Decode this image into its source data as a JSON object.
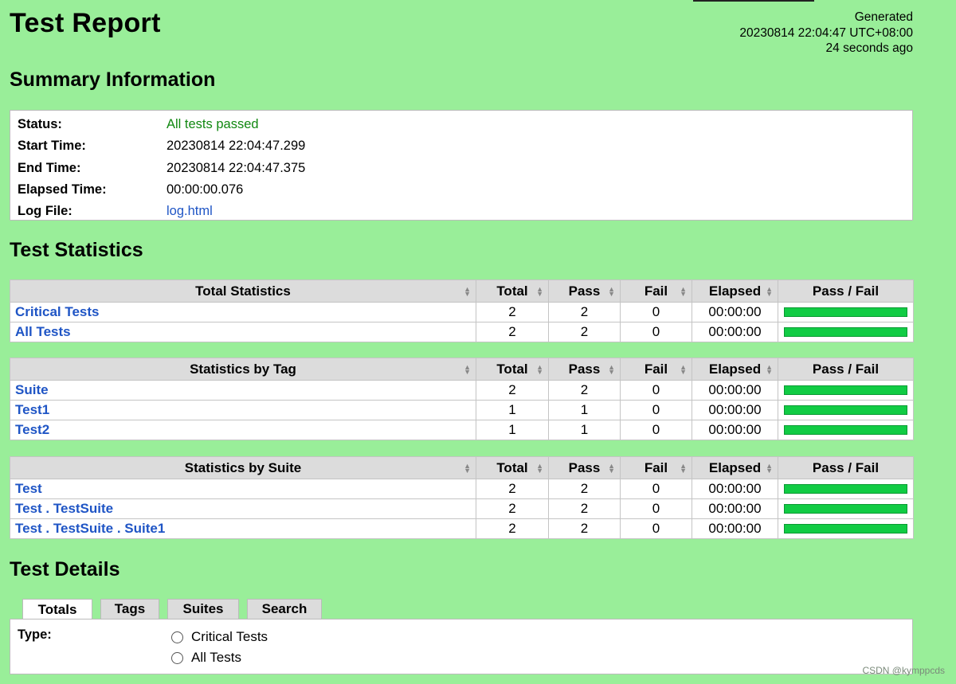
{
  "header": {
    "title": "Test Report",
    "generated_label": "Generated",
    "generated_time": "20230814 22:04:47 UTC+08:00",
    "generated_ago": "24 seconds ago"
  },
  "summary": {
    "heading": "Summary Information",
    "rows": [
      {
        "label": "Status:",
        "value": "All tests passed"
      },
      {
        "label": "Start Time:",
        "value": "20230814 22:04:47.299"
      },
      {
        "label": "End Time:",
        "value": "20230814 22:04:47.375"
      },
      {
        "label": "Elapsed Time:",
        "value": "00:00:00.076"
      },
      {
        "label": "Log File:",
        "value": "log.html"
      }
    ],
    "status_color": "#118811"
  },
  "statistics": {
    "heading": "Test Statistics",
    "columns": [
      "Total",
      "Pass",
      "Fail",
      "Elapsed",
      "Pass / Fail"
    ],
    "tables": [
      {
        "title": "Total Statistics",
        "rows": [
          {
            "name": "Critical Tests",
            "total": "2",
            "pass": "2",
            "fail": "0",
            "elapsed": "00:00:00",
            "pass_ratio": 1.0
          },
          {
            "name": "All Tests",
            "total": "2",
            "pass": "2",
            "fail": "0",
            "elapsed": "00:00:00",
            "pass_ratio": 1.0
          }
        ]
      },
      {
        "title": "Statistics by Tag",
        "rows": [
          {
            "name": "Suite",
            "total": "2",
            "pass": "2",
            "fail": "0",
            "elapsed": "00:00:00",
            "pass_ratio": 1.0
          },
          {
            "name": "Test1",
            "total": "1",
            "pass": "1",
            "fail": "0",
            "elapsed": "00:00:00",
            "pass_ratio": 1.0
          },
          {
            "name": "Test2",
            "total": "1",
            "pass": "1",
            "fail": "0",
            "elapsed": "00:00:00",
            "pass_ratio": 1.0
          }
        ]
      },
      {
        "title": "Statistics by Suite",
        "rows": [
          {
            "name": "Test",
            "total": "2",
            "pass": "2",
            "fail": "0",
            "elapsed": "00:00:00",
            "pass_ratio": 1.0
          },
          {
            "name": "Test . TestSuite",
            "total": "2",
            "pass": "2",
            "fail": "0",
            "elapsed": "00:00:00",
            "pass_ratio": 1.0
          },
          {
            "name": "Test . TestSuite . Suite1",
            "total": "2",
            "pass": "2",
            "fail": "0",
            "elapsed": "00:00:00",
            "pass_ratio": 1.0
          }
        ]
      }
    ]
  },
  "details": {
    "heading": "Test Details",
    "tabs": [
      "Totals",
      "Tags",
      "Suites",
      "Search"
    ],
    "active_tab": "Totals",
    "type_label": "Type:",
    "options": [
      "Critical Tests",
      "All Tests"
    ]
  },
  "watermark": "CSDN @kymppcds",
  "colors": {
    "background": "#99ee99",
    "pass_bar": "#11cc44",
    "link": "#1f55c5"
  }
}
